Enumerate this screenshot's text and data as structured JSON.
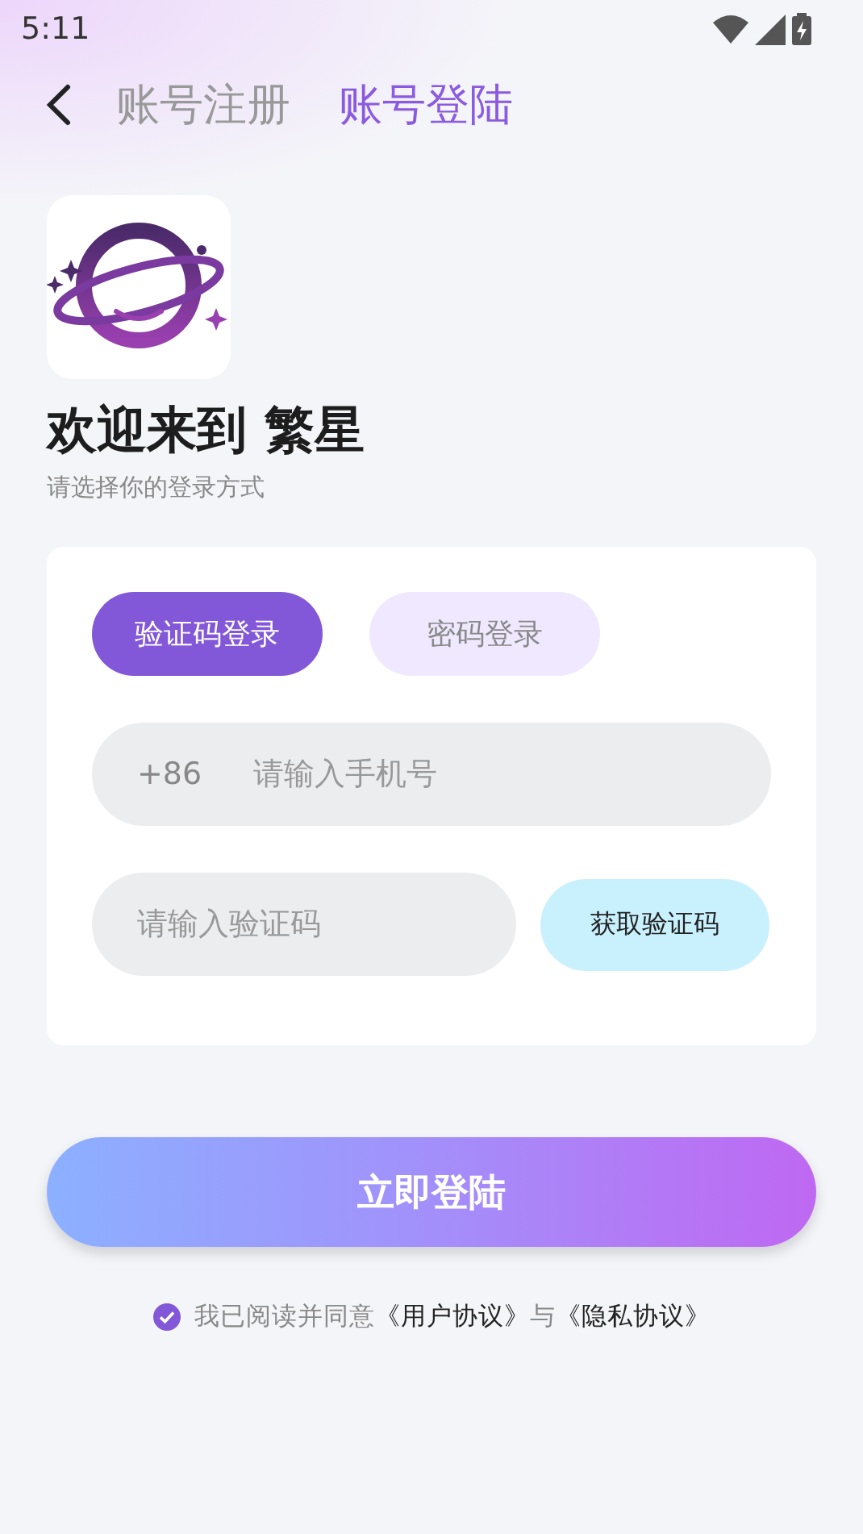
{
  "status_bar": {
    "time": "5:11"
  },
  "header": {
    "tabs": [
      {
        "label": "账号注册",
        "selected": false
      },
      {
        "label": "账号登陆",
        "selected": true
      }
    ]
  },
  "welcome": {
    "title": "欢迎来到 繁星",
    "subtitle": "请选择你的登录方式"
  },
  "login_card": {
    "modes": [
      {
        "label": "验证码登录",
        "selected": true
      },
      {
        "label": "密码登录",
        "selected": false
      }
    ],
    "phone": {
      "prefix": "+86",
      "placeholder": "请输入手机号"
    },
    "code": {
      "placeholder": "请输入验证码"
    },
    "get_code_button": "获取验证码"
  },
  "submit_button": "立即登陆",
  "agreement": {
    "checked": true,
    "parts": [
      {
        "kind": "text",
        "text": "我已阅读并同意"
      },
      {
        "kind": "link",
        "text": "《用户协议》"
      },
      {
        "kind": "text",
        "text": "与"
      },
      {
        "kind": "link",
        "text": "《隐私协议》"
      }
    ]
  }
}
